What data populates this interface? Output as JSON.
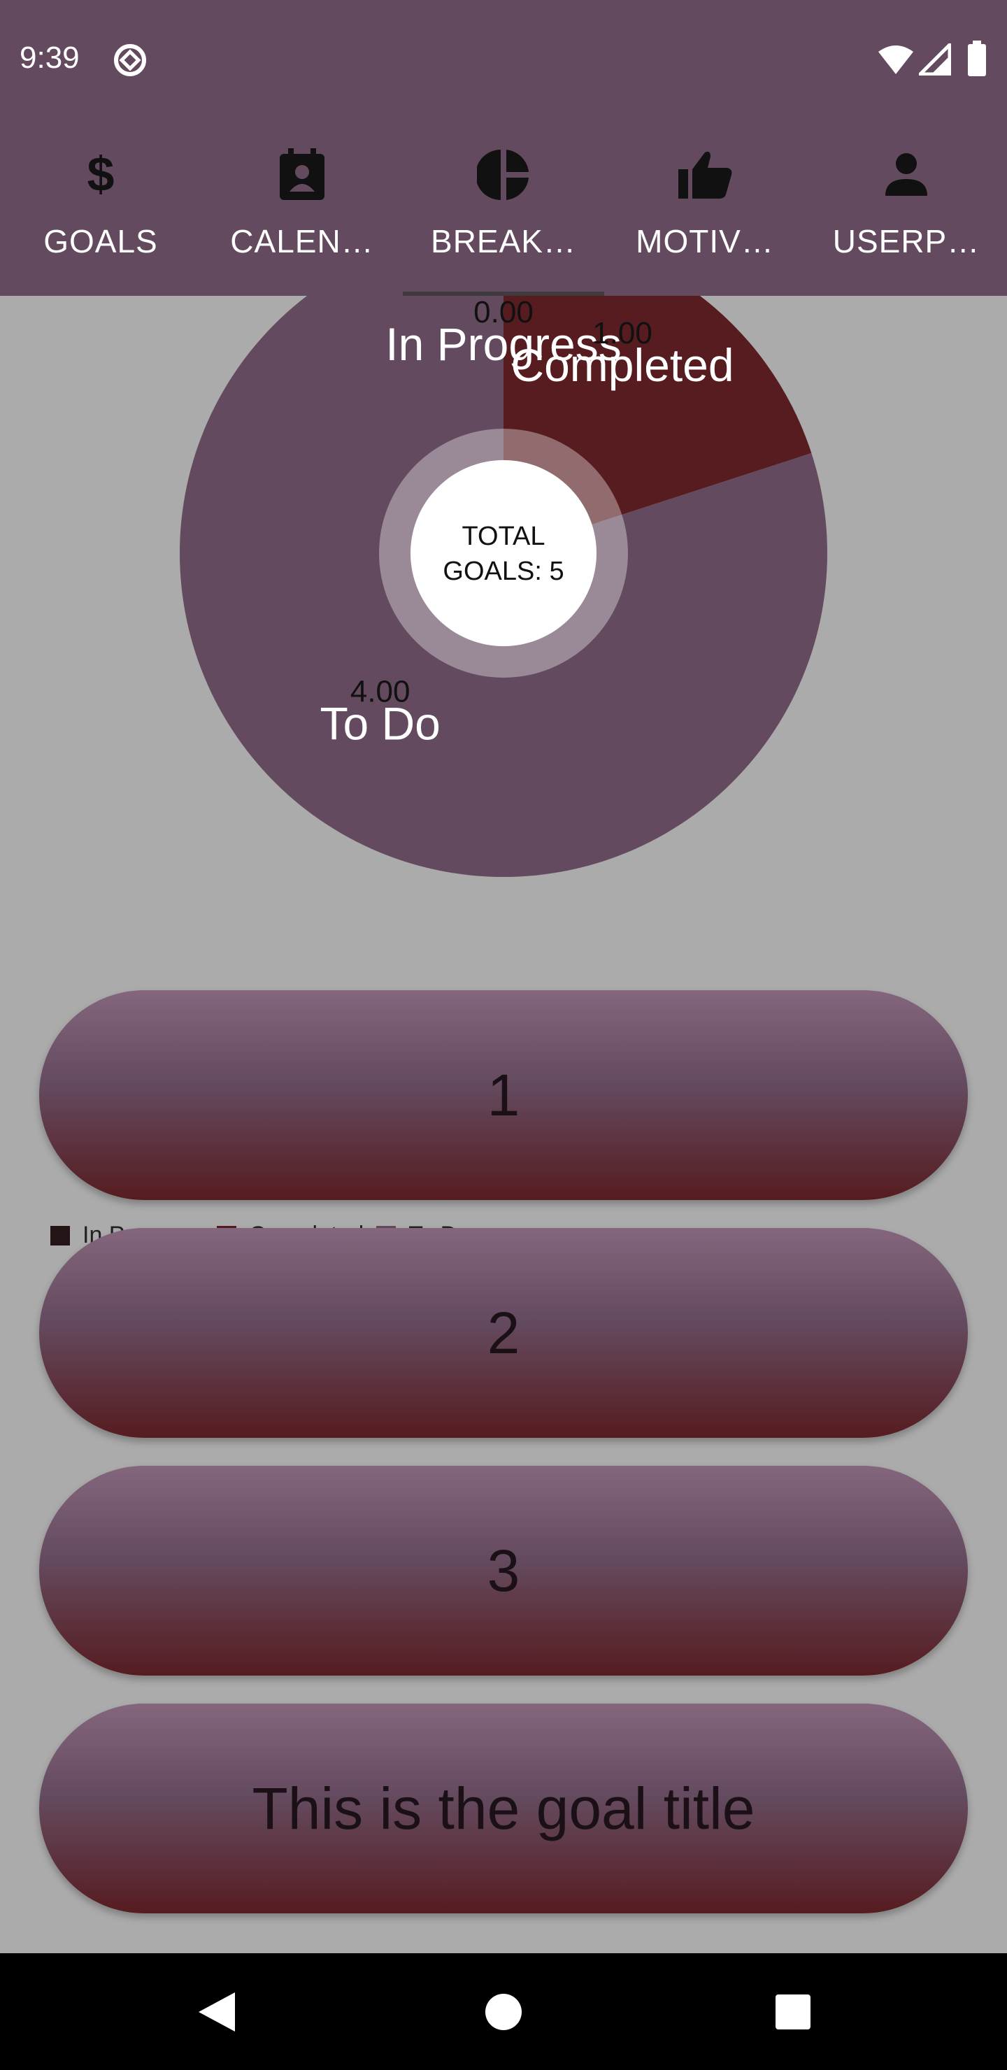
{
  "status": {
    "time": "9:39",
    "icons": [
      "sync-icon",
      "wifi-icon",
      "cell-signal-icon",
      "battery-icon"
    ]
  },
  "tabs": [
    {
      "label": "GOALS",
      "icon": "dollar-icon",
      "selected": false
    },
    {
      "label": "CALEN…",
      "icon": "calendar-contact-icon",
      "selected": false
    },
    {
      "label": "BREAK…",
      "icon": "pie-chart-icon",
      "selected": true
    },
    {
      "label": "MOTIV…",
      "icon": "thumb-up-icon",
      "selected": false
    },
    {
      "label": "USERP…",
      "icon": "person-icon",
      "selected": false
    }
  ],
  "chart_data": {
    "type": "pie",
    "categories": [
      "In Progress",
      "Completed",
      "To Do"
    ],
    "values": [
      0,
      1,
      4
    ],
    "value_labels": [
      "0.00",
      "1.00",
      "4.00"
    ],
    "colors": [
      "#231516",
      "#561c20",
      "#644a5e"
    ],
    "center_text_line1": "TOTAL",
    "center_text_line2": "GOALS: 5",
    "legend": [
      "In Progress",
      "Completed",
      "To Do"
    ],
    "legend_position": "bottom-left"
  },
  "goals": [
    {
      "title": "1"
    },
    {
      "title": "2"
    },
    {
      "title": "3"
    },
    {
      "title": "This is the goal title"
    }
  ],
  "nav": [
    "back-icon",
    "home-icon",
    "recents-icon"
  ]
}
